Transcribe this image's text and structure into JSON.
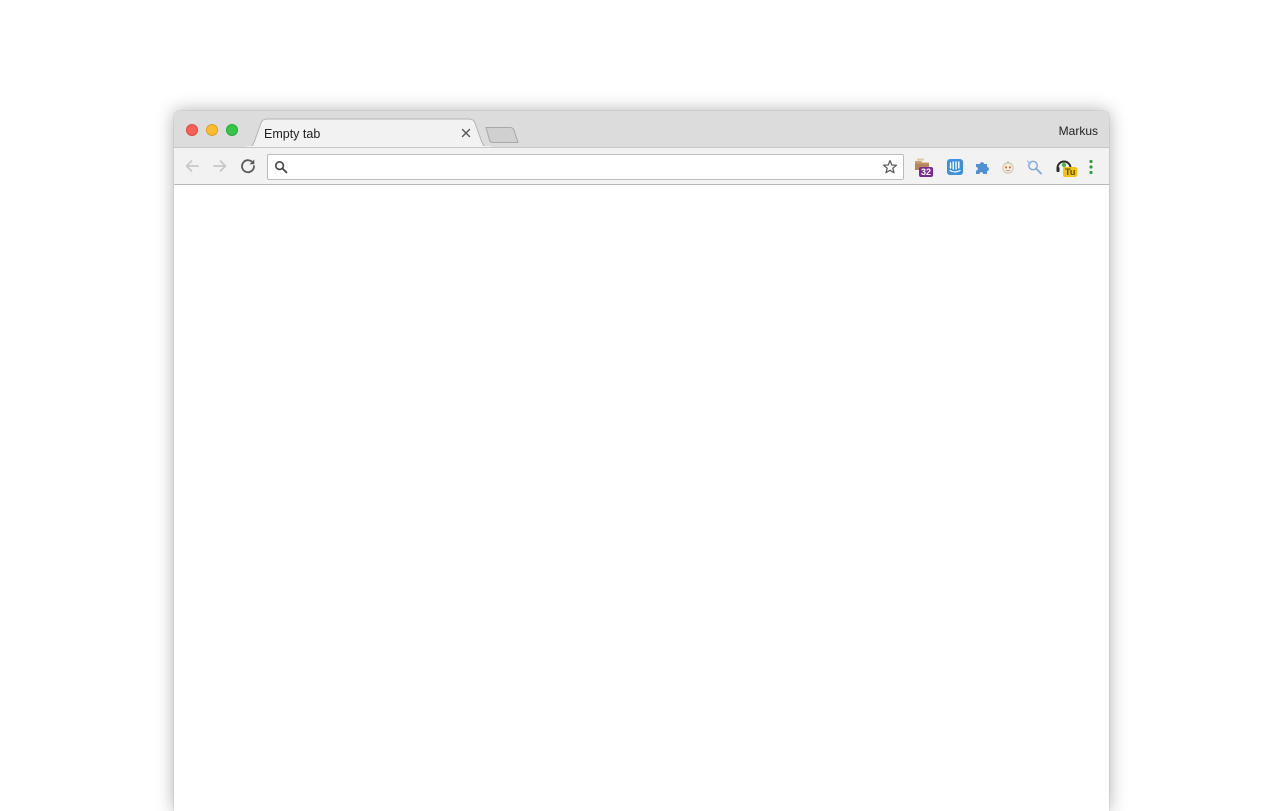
{
  "window": {
    "profile_name": "Markus"
  },
  "tabs": [
    {
      "title": "Empty tab",
      "active": true
    }
  ],
  "toolbar": {
    "back_enabled": false,
    "forward_enabled": false,
    "address_value": "",
    "address_placeholder": ""
  },
  "extensions": [
    {
      "icon": "calendar-folder-icon",
      "badge": "32",
      "badge_color": "#7a2b8f"
    },
    {
      "icon": "intercom-icon"
    },
    {
      "icon": "puzzle-piece-icon"
    },
    {
      "icon": "robot-face-icon"
    },
    {
      "icon": "magnifier-pin-icon"
    },
    {
      "icon": "headset-icon",
      "badge": "Tu",
      "badge_color": "#f1c40f"
    }
  ],
  "colors": {
    "titlebar": "#dcdcdc",
    "toolbar": "#f2f2f2",
    "close": "#fc5f57",
    "minimize": "#fdbc2e",
    "maximize": "#33c748",
    "menu_dots": "#2e9e3f"
  }
}
